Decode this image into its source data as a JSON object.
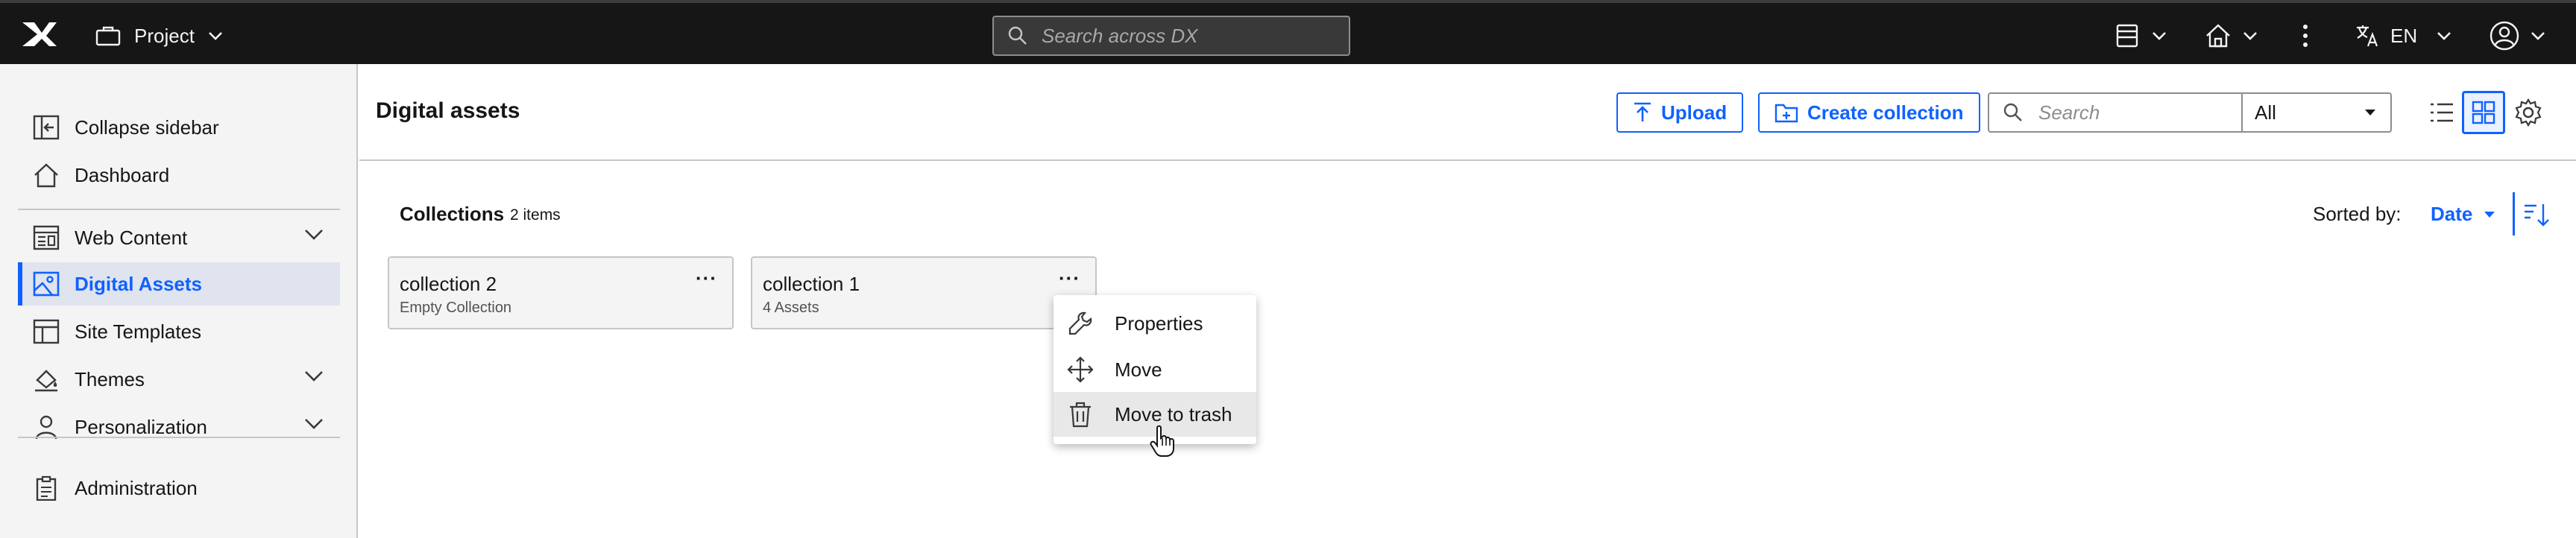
{
  "topbar": {
    "project_label": "Project",
    "search_placeholder": "Search across DX",
    "language": "EN"
  },
  "sidebar": {
    "items": [
      {
        "label": "Collapse sidebar",
        "icon": "collapse-icon"
      },
      {
        "label": "Dashboard",
        "icon": "home-icon"
      },
      {
        "label": "Web Content",
        "icon": "web-content-icon",
        "expandable": true
      },
      {
        "label": "Digital Assets",
        "icon": "image-icon",
        "active": true
      },
      {
        "label": "Site Templates",
        "icon": "template-icon"
      },
      {
        "label": "Themes",
        "icon": "paint-icon",
        "expandable": true
      },
      {
        "label": "Personalization",
        "icon": "user-icon",
        "expandable": true
      },
      {
        "label": "Administration",
        "icon": "clipboard-icon"
      }
    ]
  },
  "header": {
    "title": "Digital assets",
    "upload_label": "Upload",
    "create_collection_label": "Create collection",
    "search_placeholder": "Search",
    "filter_value": "All"
  },
  "collections": {
    "title": "Collections",
    "count": "2 items",
    "sorted_by_label": "Sorted by:",
    "sort_value": "Date",
    "cards": [
      {
        "name": "collection 2",
        "subtitle": "Empty Collection"
      },
      {
        "name": "collection 1",
        "subtitle": "4 Assets"
      }
    ],
    "more_label": "···"
  },
  "context_menu": {
    "items": [
      {
        "label": "Properties",
        "icon": "wrench-icon"
      },
      {
        "label": "Move",
        "icon": "move-icon"
      },
      {
        "label": "Move to trash",
        "icon": "trash-icon",
        "hovered": true
      }
    ]
  },
  "colors": {
    "accent": "#0f62fe",
    "topbar": "#161616",
    "sidebar": "#f4f4f4"
  }
}
